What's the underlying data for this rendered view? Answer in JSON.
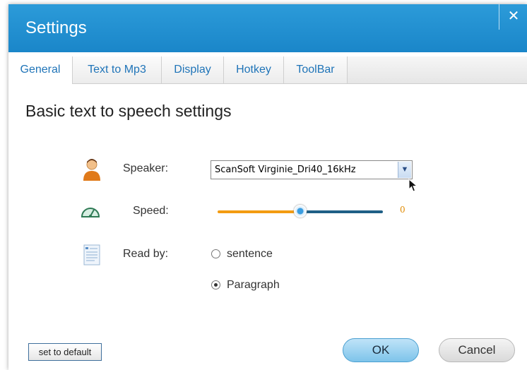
{
  "window": {
    "title": "Settings",
    "close_glyph": "✕"
  },
  "tabs": [
    {
      "label": "General",
      "active": true
    },
    {
      "label": "Text  to Mp3",
      "active": false
    },
    {
      "label": "Display",
      "active": false
    },
    {
      "label": "Hotkey",
      "active": false
    },
    {
      "label": "ToolBar",
      "active": false
    }
  ],
  "section": {
    "heading": "Basic text to speech settings"
  },
  "speaker": {
    "label": "Speaker:",
    "selected": "ScanSoft Virginie_Dri40_16kHz",
    "icon": "user-icon"
  },
  "speed": {
    "label": "Speed:",
    "value": "0",
    "slider_fraction": 0.5,
    "icon": "speedometer-icon"
  },
  "read_by": {
    "label": "Read by:",
    "icon": "document-icon",
    "options": [
      {
        "label": "sentence",
        "selected": false
      },
      {
        "label": "Paragraph",
        "selected": true
      }
    ]
  },
  "buttons": {
    "default": "set to default",
    "ok": "OK",
    "cancel": "Cancel"
  },
  "colors": {
    "title_bar": "#1a86c9",
    "tab_text": "#1f74b8",
    "slider_fill": "#f39c12",
    "slider_track": "#1f5f86"
  }
}
